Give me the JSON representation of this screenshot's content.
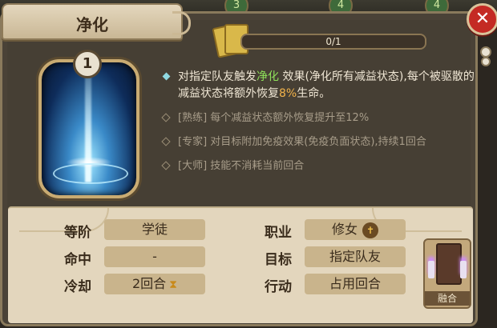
{
  "background_badges": [
    "3",
    "4",
    "4"
  ],
  "title": "净化",
  "skill": {
    "level": "1",
    "icon": "purify-light-beam"
  },
  "progress": {
    "text": "0/1",
    "fraction": 0
  },
  "description": {
    "p1": "对指定队友触发",
    "keyword": "净化",
    "p2": "效果(净化所有减益状态),每个被驱散的减益状态将额外恢复",
    "percent": "8%",
    "p3": "生命。"
  },
  "upgrades": [
    "[熟练] 每个减益状态额外恢复提升至12%",
    "[专家] 对目标附加免疫效果(免疫负面状态),持续1回合",
    "[大师] 技能不消耗当前回合"
  ],
  "stats": {
    "rank_label": "等阶",
    "rank_value": "学徒",
    "hit_label": "命中",
    "hit_value": "-",
    "cooldown_label": "冷却",
    "cooldown_value": "2回合",
    "class_label": "职业",
    "class_value": "修女",
    "target_label": "目标",
    "target_value": "指定队友",
    "action_label": "行动",
    "action_value": "占用回合"
  },
  "fusion_label": "融合",
  "colors": {
    "keyword": "#8ee05a",
    "percent": "#f1b24a",
    "close": "#c42a24",
    "progress_fill": "#d6b34c"
  }
}
